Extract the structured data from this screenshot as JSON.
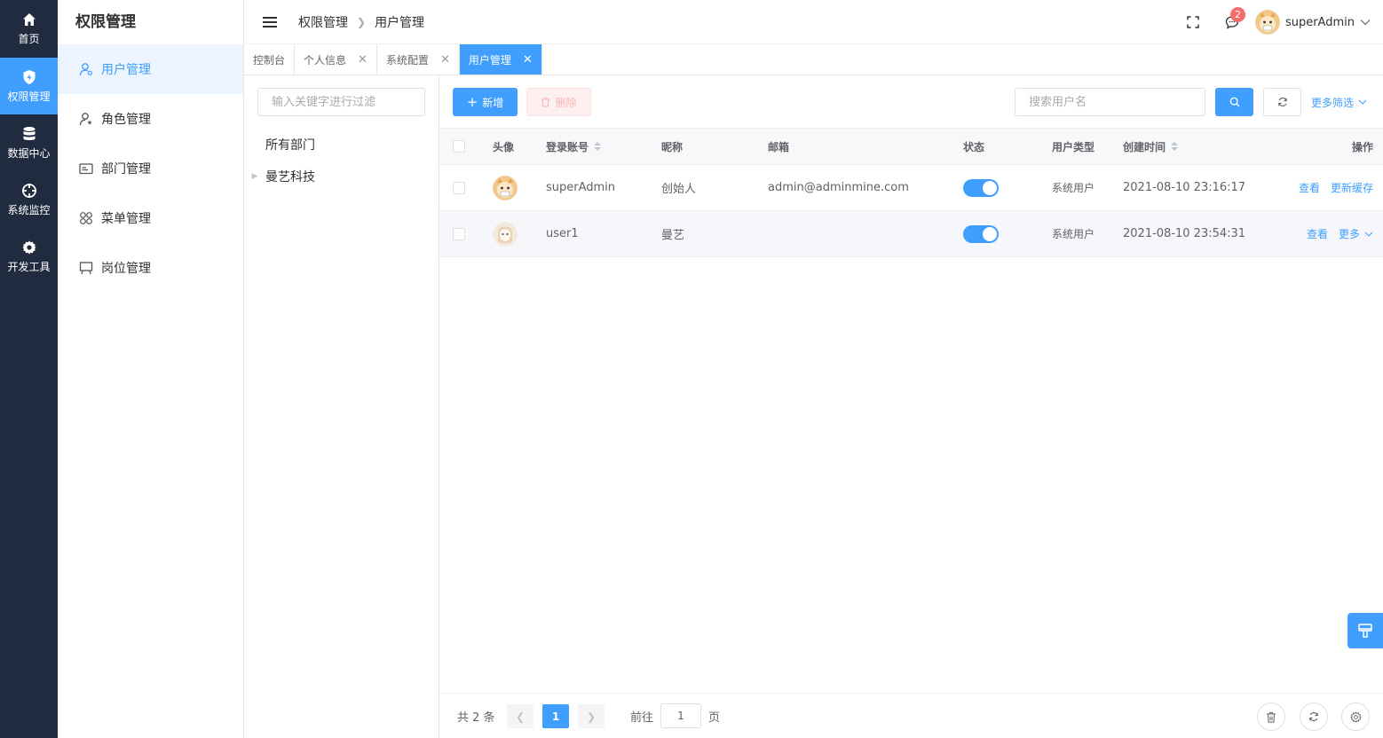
{
  "rail": {
    "items": [
      {
        "label": "首页",
        "icon": "home-icon"
      },
      {
        "label": "权限管理",
        "icon": "shield-icon"
      },
      {
        "label": "数据中心",
        "icon": "database-icon"
      },
      {
        "label": "系统监控",
        "icon": "crosshair-icon"
      },
      {
        "label": "开发工具",
        "icon": "gear-icon"
      }
    ],
    "active_index": 1
  },
  "submenu": {
    "title": "权限管理",
    "items": [
      {
        "label": "用户管理",
        "icon": "user-icon"
      },
      {
        "label": "角色管理",
        "icon": "user-star-icon"
      },
      {
        "label": "部门管理",
        "icon": "id-card-icon"
      },
      {
        "label": "菜单管理",
        "icon": "grid-icon"
      },
      {
        "label": "岗位管理",
        "icon": "easel-icon"
      }
    ],
    "active_index": 0
  },
  "header": {
    "breadcrumb": [
      "权限管理",
      "用户管理"
    ],
    "notification_count": "2",
    "user_name": "superAdmin"
  },
  "tabs": [
    {
      "label": "控制台",
      "closable": false
    },
    {
      "label": "个人信息",
      "closable": true
    },
    {
      "label": "系统配置",
      "closable": true
    },
    {
      "label": "用户管理",
      "closable": true,
      "active": true
    }
  ],
  "dept": {
    "filter_placeholder": "输入关键字进行过滤",
    "tree": [
      {
        "label": "所有部门",
        "expandable": false
      },
      {
        "label": "曼艺科技",
        "expandable": true
      }
    ]
  },
  "toolbar": {
    "add_label": "新增",
    "delete_label": "删除",
    "search_placeholder": "搜索用户名",
    "more_filter_label": "更多筛选"
  },
  "table": {
    "columns": {
      "avatar": "头像",
      "account": "登录账号",
      "nickname": "昵称",
      "email": "邮箱",
      "status": "状态",
      "user_type": "用户类型",
      "created": "创建时间",
      "actions": "操作"
    },
    "rows": [
      {
        "account": "superAdmin",
        "nickname": "创始人",
        "email": "admin@adminmine.com",
        "status": true,
        "user_type": "系统用户",
        "created": "2021-08-10 23:16:17",
        "action1": "查看",
        "action2": "更新缓存"
      },
      {
        "account": "user1",
        "nickname": "曼艺",
        "email": "",
        "status": true,
        "user_type": "系统用户",
        "created": "2021-08-10 23:54:31",
        "action1": "查看",
        "action2": "更多"
      }
    ]
  },
  "pager": {
    "total_label": "共 2 条",
    "current_page": "1",
    "goto_prefix": "前往",
    "goto_value": "1",
    "goto_suffix": "页"
  },
  "colors": {
    "primary": "#409eff",
    "rail_bg": "#212b40",
    "danger": "#f56c6c"
  }
}
